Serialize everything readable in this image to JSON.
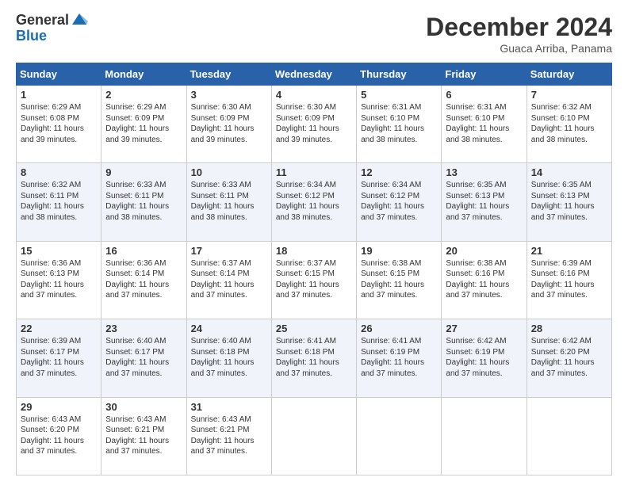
{
  "logo": {
    "general": "General",
    "blue": "Blue"
  },
  "header": {
    "month": "December 2024",
    "location": "Guaca Arriba, Panama"
  },
  "days_header": [
    "Sunday",
    "Monday",
    "Tuesday",
    "Wednesday",
    "Thursday",
    "Friday",
    "Saturday"
  ],
  "weeks": [
    [
      {
        "day": "1",
        "sunrise": "6:29 AM",
        "sunset": "6:08 PM",
        "daylight": "11 hours and 39 minutes."
      },
      {
        "day": "2",
        "sunrise": "6:29 AM",
        "sunset": "6:09 PM",
        "daylight": "11 hours and 39 minutes."
      },
      {
        "day": "3",
        "sunrise": "6:30 AM",
        "sunset": "6:09 PM",
        "daylight": "11 hours and 39 minutes."
      },
      {
        "day": "4",
        "sunrise": "6:30 AM",
        "sunset": "6:09 PM",
        "daylight": "11 hours and 39 minutes."
      },
      {
        "day": "5",
        "sunrise": "6:31 AM",
        "sunset": "6:10 PM",
        "daylight": "11 hours and 38 minutes."
      },
      {
        "day": "6",
        "sunrise": "6:31 AM",
        "sunset": "6:10 PM",
        "daylight": "11 hours and 38 minutes."
      },
      {
        "day": "7",
        "sunrise": "6:32 AM",
        "sunset": "6:10 PM",
        "daylight": "11 hours and 38 minutes."
      }
    ],
    [
      {
        "day": "8",
        "sunrise": "6:32 AM",
        "sunset": "6:11 PM",
        "daylight": "11 hours and 38 minutes."
      },
      {
        "day": "9",
        "sunrise": "6:33 AM",
        "sunset": "6:11 PM",
        "daylight": "11 hours and 38 minutes."
      },
      {
        "day": "10",
        "sunrise": "6:33 AM",
        "sunset": "6:11 PM",
        "daylight": "11 hours and 38 minutes."
      },
      {
        "day": "11",
        "sunrise": "6:34 AM",
        "sunset": "6:12 PM",
        "daylight": "11 hours and 38 minutes."
      },
      {
        "day": "12",
        "sunrise": "6:34 AM",
        "sunset": "6:12 PM",
        "daylight": "11 hours and 37 minutes."
      },
      {
        "day": "13",
        "sunrise": "6:35 AM",
        "sunset": "6:13 PM",
        "daylight": "11 hours and 37 minutes."
      },
      {
        "day": "14",
        "sunrise": "6:35 AM",
        "sunset": "6:13 PM",
        "daylight": "11 hours and 37 minutes."
      }
    ],
    [
      {
        "day": "15",
        "sunrise": "6:36 AM",
        "sunset": "6:13 PM",
        "daylight": "11 hours and 37 minutes."
      },
      {
        "day": "16",
        "sunrise": "6:36 AM",
        "sunset": "6:14 PM",
        "daylight": "11 hours and 37 minutes."
      },
      {
        "day": "17",
        "sunrise": "6:37 AM",
        "sunset": "6:14 PM",
        "daylight": "11 hours and 37 minutes."
      },
      {
        "day": "18",
        "sunrise": "6:37 AM",
        "sunset": "6:15 PM",
        "daylight": "11 hours and 37 minutes."
      },
      {
        "day": "19",
        "sunrise": "6:38 AM",
        "sunset": "6:15 PM",
        "daylight": "11 hours and 37 minutes."
      },
      {
        "day": "20",
        "sunrise": "6:38 AM",
        "sunset": "6:16 PM",
        "daylight": "11 hours and 37 minutes."
      },
      {
        "day": "21",
        "sunrise": "6:39 AM",
        "sunset": "6:16 PM",
        "daylight": "11 hours and 37 minutes."
      }
    ],
    [
      {
        "day": "22",
        "sunrise": "6:39 AM",
        "sunset": "6:17 PM",
        "daylight": "11 hours and 37 minutes."
      },
      {
        "day": "23",
        "sunrise": "6:40 AM",
        "sunset": "6:17 PM",
        "daylight": "11 hours and 37 minutes."
      },
      {
        "day": "24",
        "sunrise": "6:40 AM",
        "sunset": "6:18 PM",
        "daylight": "11 hours and 37 minutes."
      },
      {
        "day": "25",
        "sunrise": "6:41 AM",
        "sunset": "6:18 PM",
        "daylight": "11 hours and 37 minutes."
      },
      {
        "day": "26",
        "sunrise": "6:41 AM",
        "sunset": "6:19 PM",
        "daylight": "11 hours and 37 minutes."
      },
      {
        "day": "27",
        "sunrise": "6:42 AM",
        "sunset": "6:19 PM",
        "daylight": "11 hours and 37 minutes."
      },
      {
        "day": "28",
        "sunrise": "6:42 AM",
        "sunset": "6:20 PM",
        "daylight": "11 hours and 37 minutes."
      }
    ],
    [
      {
        "day": "29",
        "sunrise": "6:43 AM",
        "sunset": "6:20 PM",
        "daylight": "11 hours and 37 minutes."
      },
      {
        "day": "30",
        "sunrise": "6:43 AM",
        "sunset": "6:21 PM",
        "daylight": "11 hours and 37 minutes."
      },
      {
        "day": "31",
        "sunrise": "6:43 AM",
        "sunset": "6:21 PM",
        "daylight": "11 hours and 37 minutes."
      },
      null,
      null,
      null,
      null
    ]
  ]
}
